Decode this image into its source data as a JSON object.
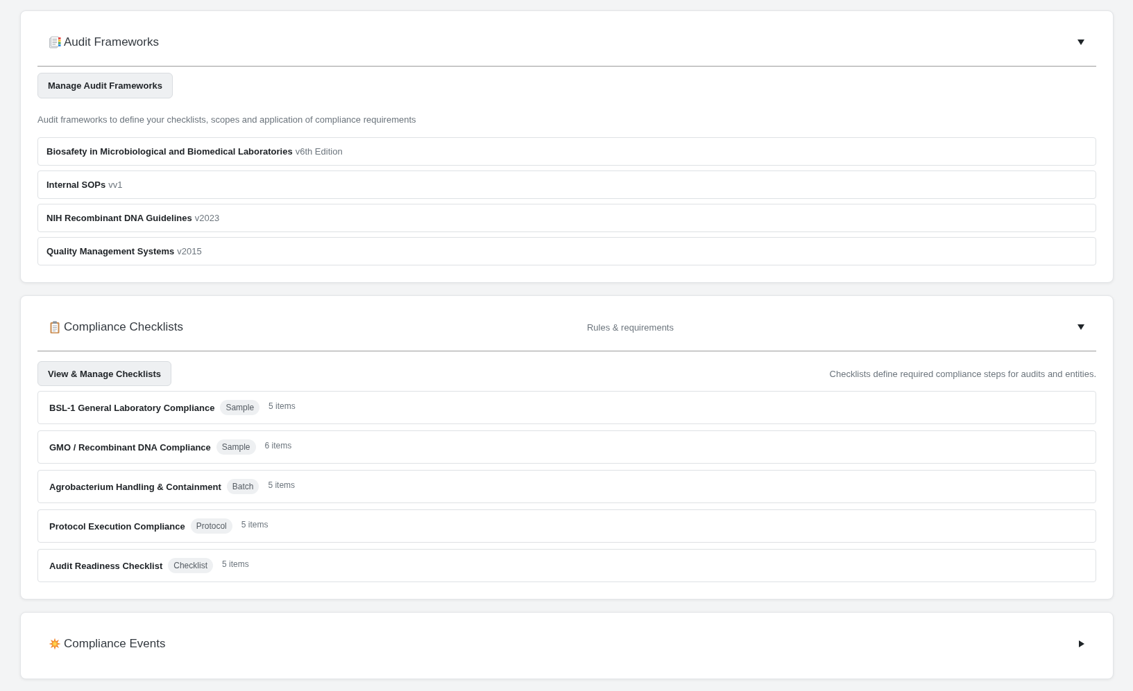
{
  "sections": [
    {
      "kind": "frameworks",
      "title": "Audit Frameworks",
      "expanded": true,
      "button": "Manage Audit Frameworks",
      "description": "Audit frameworks to define your checklists, scopes and application of compliance requirements",
      "items": [
        {
          "name": "Biosafety in Microbiological and Biomedical Laboratories",
          "version": "v6th Edition"
        },
        {
          "name": "Internal SOPs",
          "version": "vv1"
        },
        {
          "name": "NIH Recombinant DNA Guidelines",
          "version": "v2023"
        },
        {
          "name": "Quality Management Systems",
          "version": "v2015"
        }
      ]
    },
    {
      "kind": "checklists",
      "title": "Compliance Checklists",
      "subtitle": "Rules & requirements",
      "expanded": true,
      "button": "View & Manage Checklists",
      "description": "Checklists define required compliance steps for audits and entities.",
      "items": [
        {
          "name": "BSL-1 General Laboratory Compliance",
          "tag": "Sample",
          "count": "5 items"
        },
        {
          "name": "GMO / Recombinant DNA Compliance",
          "tag": "Sample",
          "count": "6 items"
        },
        {
          "name": "Agrobacterium Handling & Containment",
          "tag": "Batch",
          "count": "5 items"
        },
        {
          "name": "Protocol Execution Compliance",
          "tag": "Protocol",
          "count": "5 items"
        },
        {
          "name": "Audit Readiness Checklist",
          "tag": "Checklist",
          "count": "5 items"
        }
      ]
    },
    {
      "kind": "events",
      "title": "Compliance Events",
      "expanded": false
    }
  ]
}
